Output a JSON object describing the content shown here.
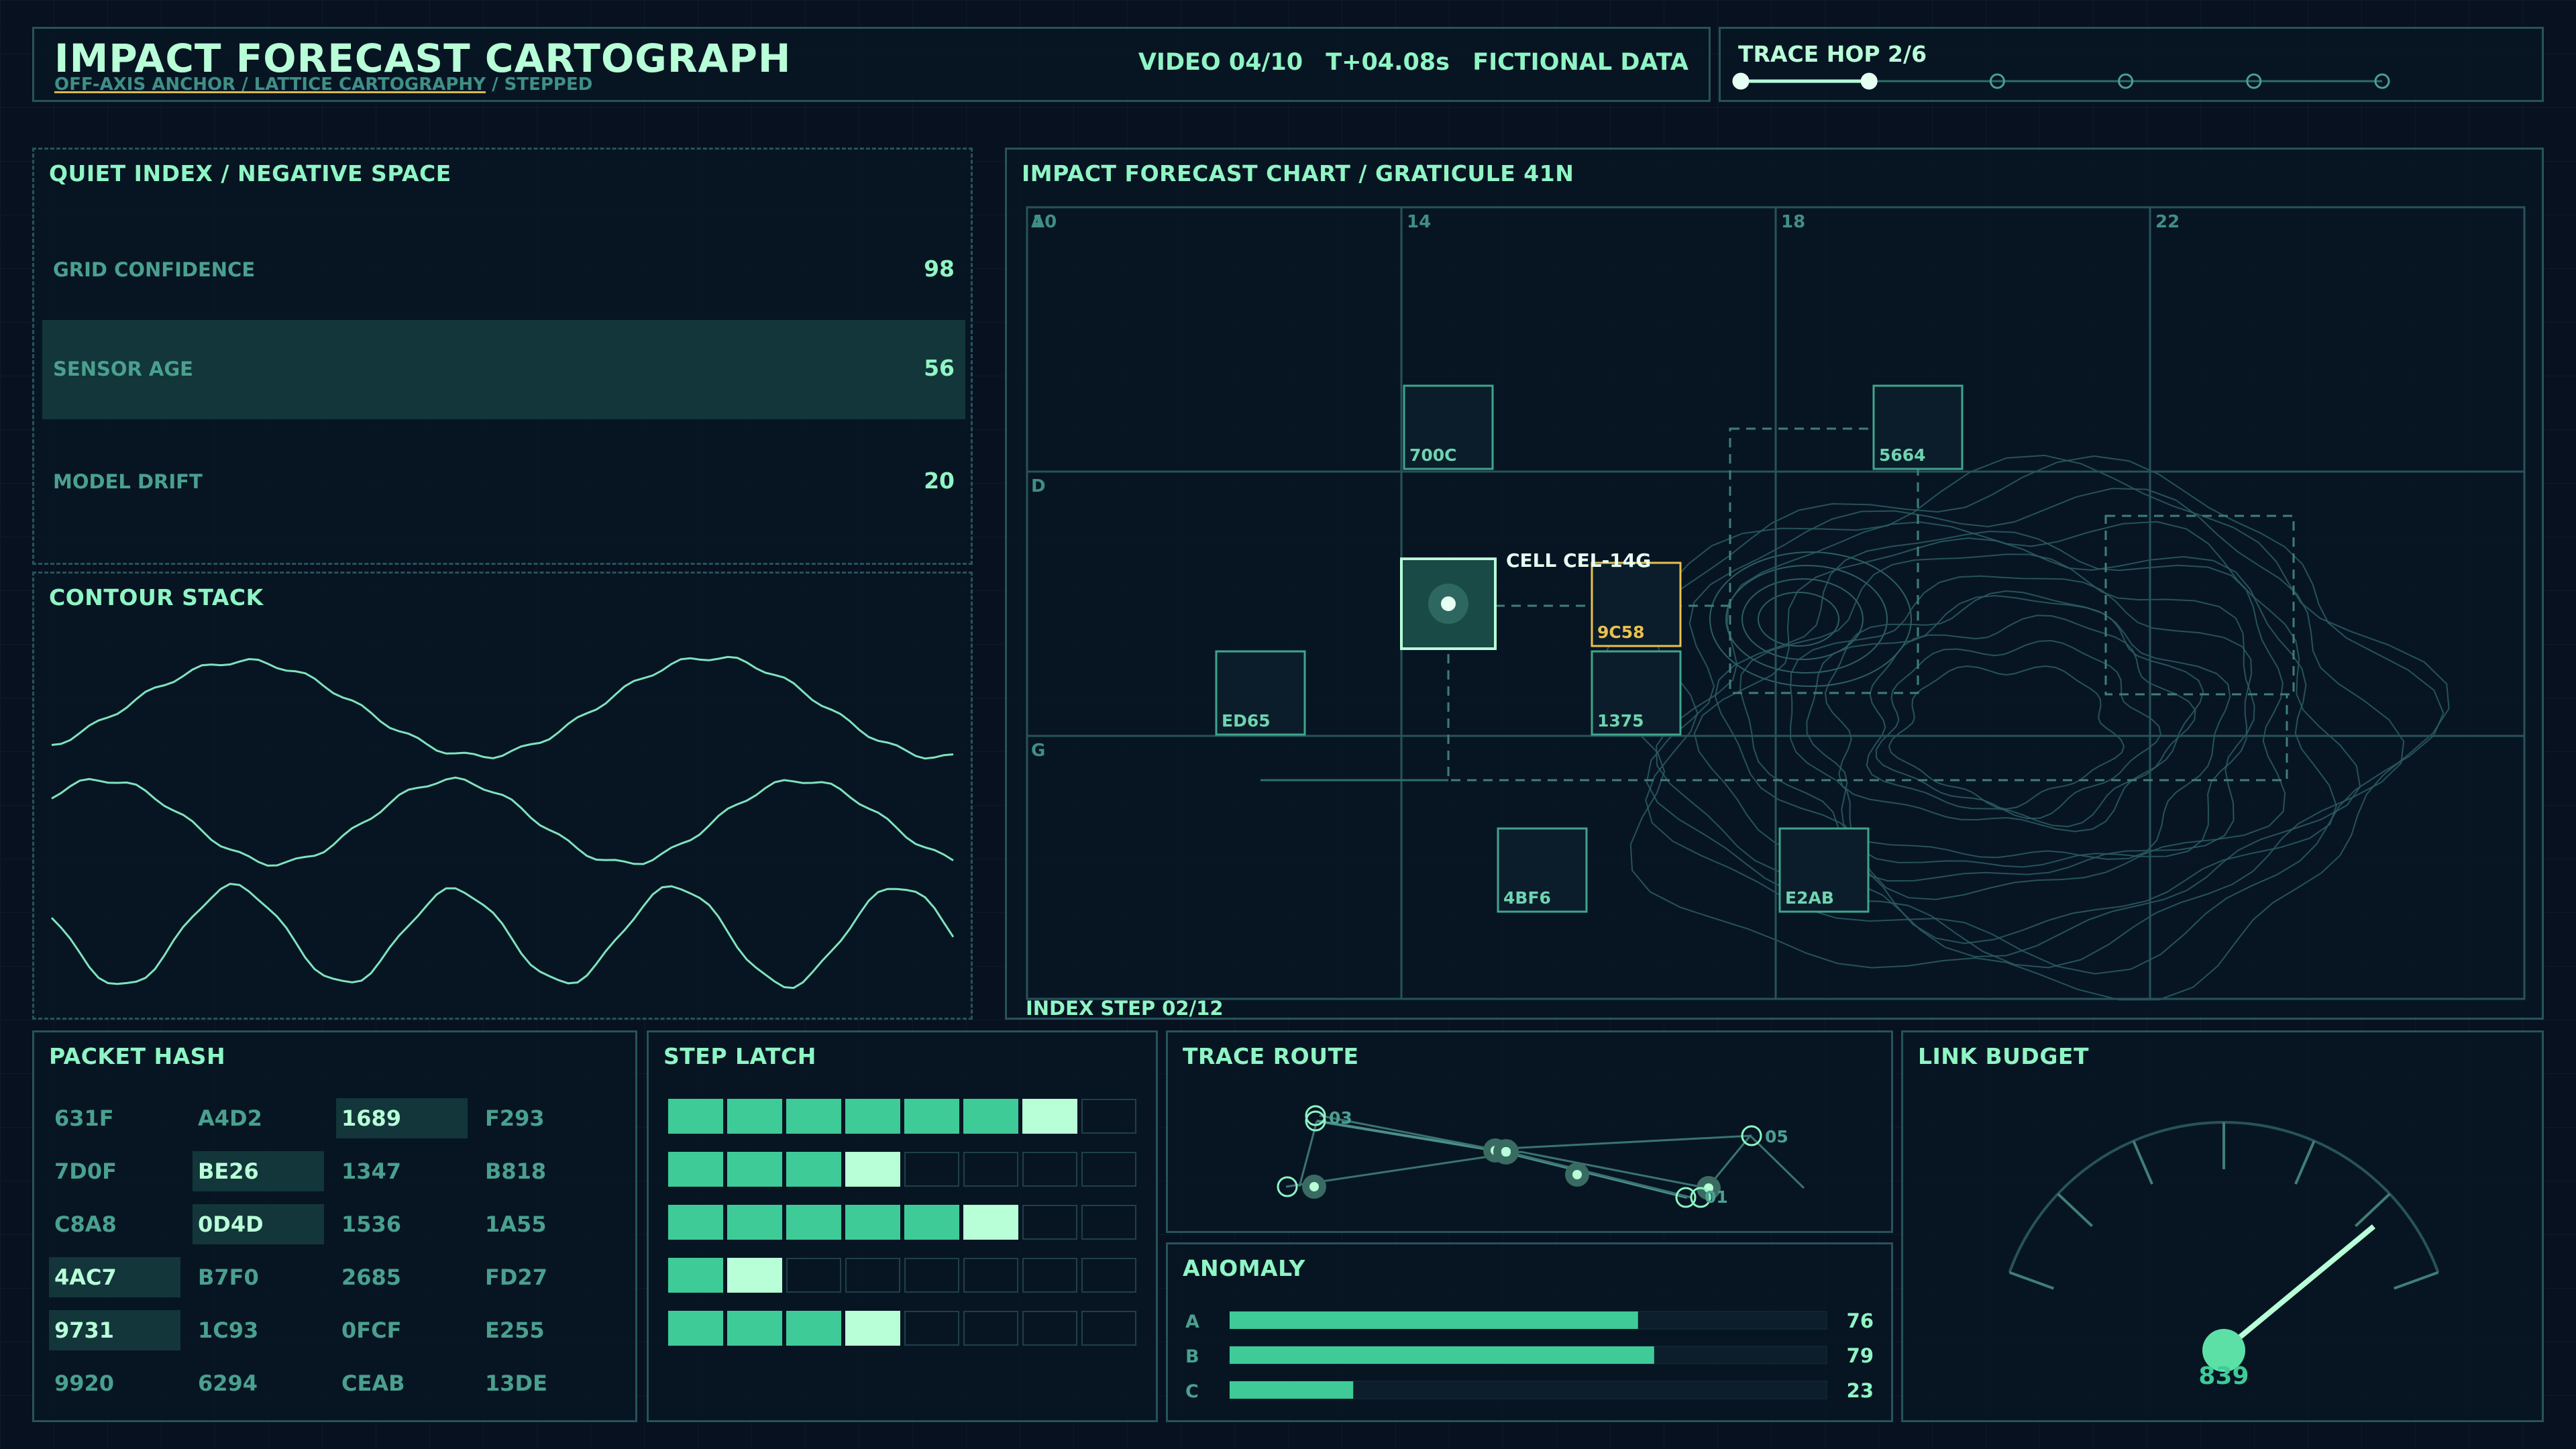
{
  "header": {
    "title": "IMPACT FORECAST CARTOGRAPH",
    "subtitle_link": "OFF-AXIS ANCHOR / LATTICE CARTOGRAPHY",
    "subtitle_rest": " / STEPPED",
    "video": "VIDEO 04/10",
    "time": "T+04.08s",
    "data_label": "FICTIONAL DATA",
    "trace_hop": "TRACE HOP 2/6",
    "hop_total": 6,
    "hop_current": 2
  },
  "quiet_index": {
    "title": "QUIET INDEX / NEGATIVE SPACE",
    "rows": [
      {
        "label": "GRID CONFIDENCE",
        "value": "98",
        "selected": false
      },
      {
        "label": "SENSOR AGE",
        "value": "56",
        "selected": true
      },
      {
        "label": "MODEL DRIFT",
        "value": "20",
        "selected": false
      }
    ]
  },
  "contour_stack": {
    "title": "CONTOUR STACK"
  },
  "forecast_chart": {
    "title": "IMPACT FORECAST CHART / GRATICULE 41N",
    "col_labels": [
      "10",
      "14",
      "18",
      "22"
    ],
    "row_labels": [
      "A",
      "D",
      "G"
    ],
    "cells": [
      "700C",
      "5664",
      "ED65",
      "1375",
      "9C58",
      "4BF6",
      "E2AB"
    ],
    "selected_cell": "CELL CEL-14G",
    "footer": "INDEX STEP 02/12"
  },
  "packet_hash": {
    "title": "PACKET HASH",
    "columns": [
      [
        "631F",
        "7D0F",
        "C8A8",
        "4AC7",
        "9731",
        "9920"
      ],
      [
        "A4D2",
        "BE26",
        "0D4D",
        "B7F0",
        "1C93",
        "6294"
      ],
      [
        "1689",
        "1347",
        "1536",
        "2685",
        "0FCF",
        "CEAB"
      ],
      [
        "F293",
        "B818",
        "1A55",
        "FD27",
        "E255",
        "13DE"
      ]
    ],
    "highlighted": [
      "4AC7",
      "9731",
      "BE26",
      "0D4D",
      "1689"
    ]
  },
  "step_latch": {
    "title": "STEP LATCH",
    "total_steps": 8,
    "rows": [
      7,
      4,
      6,
      2,
      4
    ]
  },
  "trace_route": {
    "title": "TRACE ROUTE",
    "labels": [
      "03",
      "05",
      "01"
    ]
  },
  "anomaly": {
    "title": "ANOMALY",
    "rows": [
      {
        "label": "A",
        "value": 76
      },
      {
        "label": "B",
        "value": 79
      },
      {
        "label": "C",
        "value": 23
      }
    ]
  },
  "link_budget": {
    "title": "LINK BUDGET",
    "value": "839",
    "gauge_fraction": 0.86
  },
  "colors": {
    "accent": "#8ff5c4",
    "bar": "#3ecb98",
    "bar_bright": "#b8ffd8",
    "warn": "#e8c14f",
    "border": "#27535a",
    "bg": "#07111f"
  }
}
